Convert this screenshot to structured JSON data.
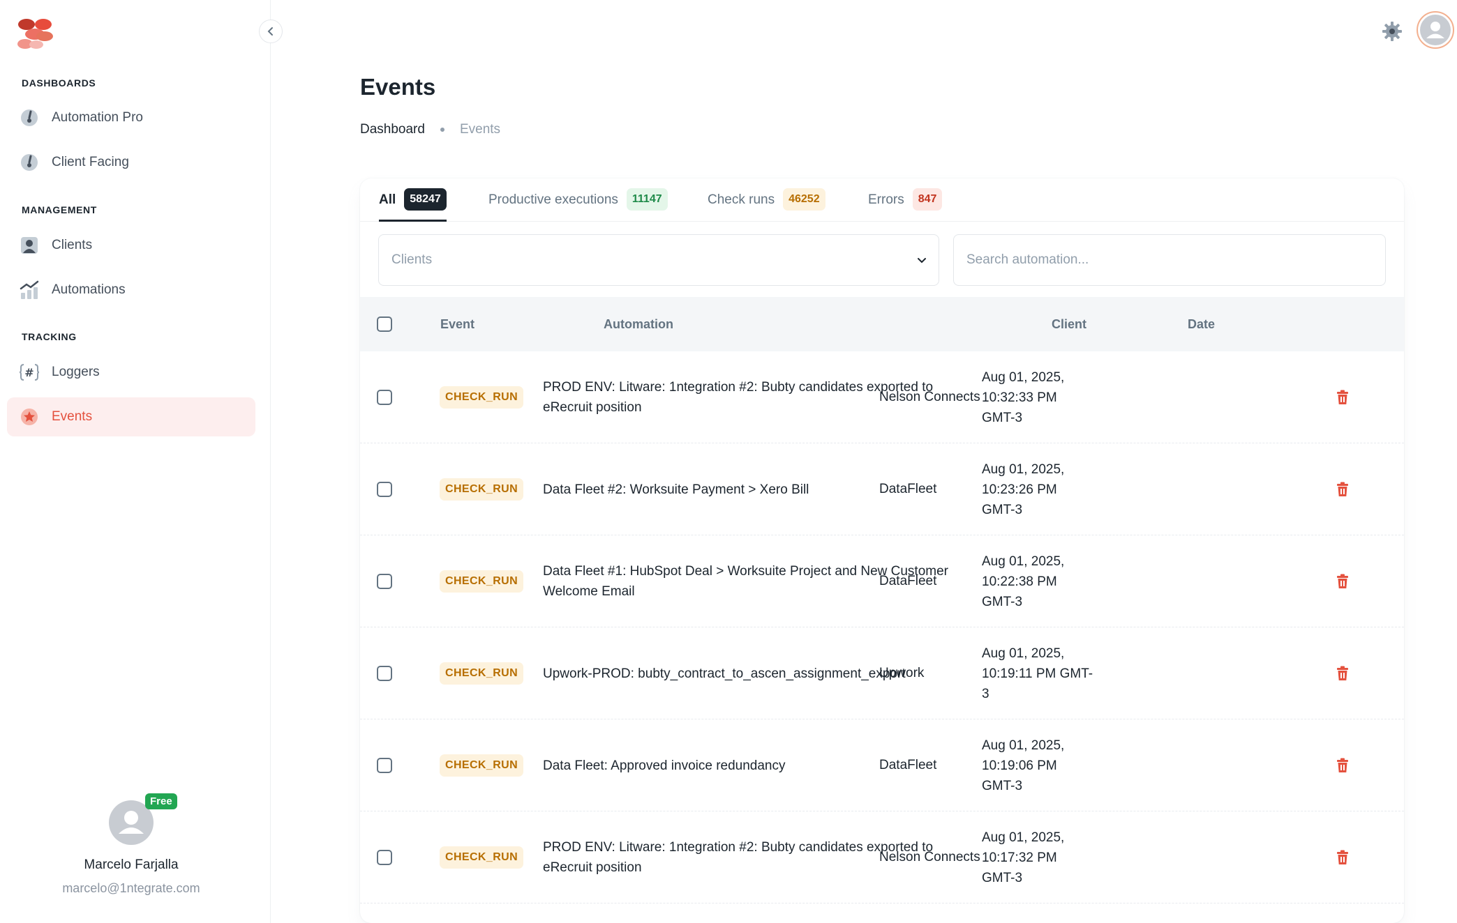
{
  "sidebar": {
    "sections": {
      "dashboards": "DASHBOARDS",
      "management": "MANAGEMENT",
      "tracking": "TRACKING"
    },
    "items": [
      {
        "label": "Automation Pro",
        "icon": "dashboard-gauge-icon"
      },
      {
        "label": "Client Facing",
        "icon": "dashboard-gauge-icon"
      },
      {
        "label": "Clients",
        "icon": "user-card-icon"
      },
      {
        "label": "Automations",
        "icon": "chart-trend-icon"
      },
      {
        "label": "Loggers",
        "icon": "hash-icon"
      },
      {
        "label": "Events",
        "icon": "star-icon",
        "active": true
      }
    ],
    "user": {
      "badge": "Free",
      "name": "Marcelo Farjalla",
      "email": "marcelo@1ntegrate.com"
    }
  },
  "header": {
    "title": "Events",
    "breadcrumb": [
      "Dashboard",
      "Events"
    ]
  },
  "tabs": [
    {
      "label": "All",
      "count": "58247"
    },
    {
      "label": "Productive executions",
      "count": "11147"
    },
    {
      "label": "Check runs",
      "count": "46252"
    },
    {
      "label": "Errors",
      "count": "847"
    }
  ],
  "filters": {
    "clients_placeholder": "Clients",
    "search_placeholder": "Search automation..."
  },
  "table": {
    "columns": [
      "Event",
      "Automation",
      "Client",
      "Date"
    ],
    "rows": [
      {
        "event": "CHECK_RUN",
        "automation": [
          "PROD ENV: Litware: 1ntegration #2: Bubty candidates exported to",
          "eRecruit position"
        ],
        "client": "Nelson Connects",
        "date": [
          "Aug 01, 2025,",
          "10:32:33 PM",
          "GMT-3"
        ]
      },
      {
        "event": "CHECK_RUN",
        "automation": [
          "Data Fleet #2: Worksuite Payment > Xero Bill"
        ],
        "client": "DataFleet",
        "date": [
          "Aug 01, 2025,",
          "10:23:26 PM",
          "GMT-3"
        ]
      },
      {
        "event": "CHECK_RUN",
        "automation": [
          "Data Fleet #1: HubSpot Deal > Worksuite Project and New Customer",
          "Welcome Email"
        ],
        "client": "DataFleet",
        "date": [
          "Aug 01, 2025,",
          "10:22:38 PM",
          "GMT-3"
        ]
      },
      {
        "event": "CHECK_RUN",
        "automation": [
          "Upwork-PROD: bubty_contract_to_ascen_assignment_export"
        ],
        "client": "Upwork",
        "date": [
          "Aug 01, 2025,",
          "10:19:11 PM GMT-",
          "3"
        ]
      },
      {
        "event": "CHECK_RUN",
        "automation": [
          "Data Fleet: Approved invoice redundancy"
        ],
        "client": "DataFleet",
        "date": [
          "Aug 01, 2025,",
          "10:19:06 PM",
          "GMT-3"
        ]
      },
      {
        "event": "CHECK_RUN",
        "automation": [
          "PROD ENV: Litware: 1ntegration #2: Bubty candidates exported to",
          "eRecruit position"
        ],
        "client": "Nelson Connects",
        "date": [
          "Aug 01, 2025,",
          "10:17:32 PM",
          "GMT-3"
        ]
      }
    ]
  },
  "colors": {
    "accent": "#e4513e",
    "badge_bg": "#fdf2dd",
    "badge_text": "#b76e00",
    "trash": "#e4513e"
  }
}
